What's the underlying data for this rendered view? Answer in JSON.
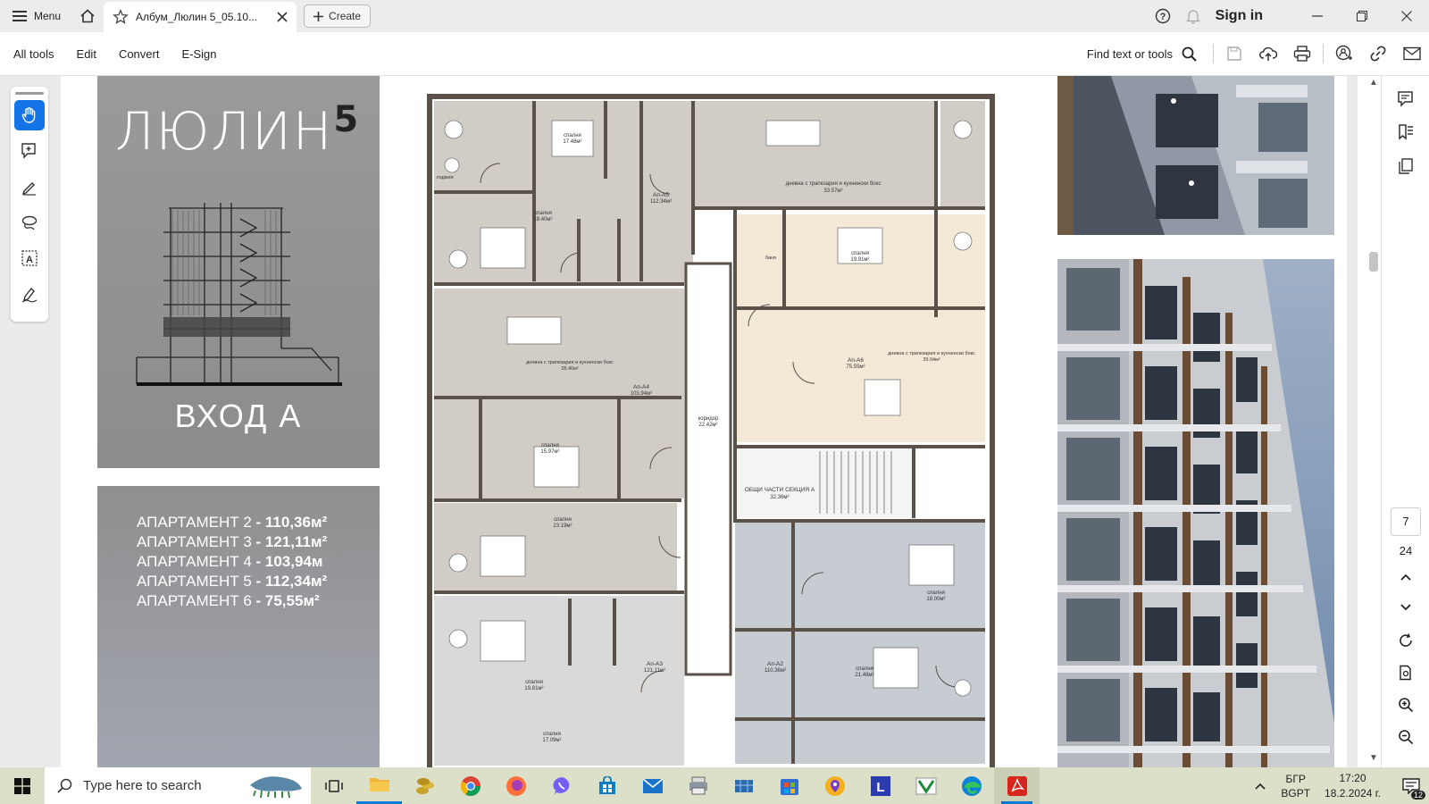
{
  "titlebar": {
    "menu_label": "Menu",
    "tab_title": "Албум_Люлин 5_05.10...",
    "create_label": "Create",
    "signin_label": "Sign in"
  },
  "toolbar": {
    "menu_items": [
      "All tools",
      "Edit",
      "Convert",
      "E-Sign"
    ],
    "find_label": "Find text or tools"
  },
  "document": {
    "cover_title": "ЛЮЛИН",
    "cover_title_mark": "5",
    "entrance_label": "ВХОД А",
    "apartments": [
      {
        "name": "АПАРТАМЕНТ 2",
        "area": "- 110,36м²"
      },
      {
        "name": "АПАРТАМЕНТ 3",
        "area": " - 121,11м²"
      },
      {
        "name": "АПАРТАМЕНТ 4",
        "area": " - 103,94м"
      },
      {
        "name": "АПАРТАМЕНТ 5",
        "area": "- 112,34м²"
      },
      {
        "name": "АПАРТАМЕНТ 6",
        "area": "- 75,55м²"
      }
    ],
    "plan_labels": {
      "a5": "Ап-А5",
      "a5_area": "112.34м²",
      "a4": "Ап-А4",
      "a4_area": "103.94м²",
      "a6": "Ап-А6",
      "a6_area": "75.55м²",
      "a3": "Ап-А3",
      "a3_area": "121.11м²",
      "a2": "Ап-А2",
      "a2_area": "110.36м²",
      "corridor": "коридор",
      "corridor_area": "22.42м²",
      "common": "ОБЩИ ЧАСТИ СЕКЦИЯ А",
      "common_area": "32.36м²",
      "living": "дневна с трапезария и кухненски бокс",
      "bedroom": "спалня",
      "bath": "баня",
      "lodge": "лоджия",
      "a53_area": "33.57м²",
      "a64_area": "39.04м²",
      "a45_area": "28.40м²",
      "a57_area": "17.48м²",
      "a58_area": "18.40м²",
      "a65_area": "19.91м²",
      "a46_area": "15.97м²",
      "a47_area": "23.19м²",
      "a27_area": "18.00м²",
      "a26_area": "21.48м²",
      "a38_area": "19.81м²",
      "a37_area": "17.09м²"
    }
  },
  "pager": {
    "current": "7",
    "total": "24"
  },
  "taskbar": {
    "search_placeholder": "Type here to search",
    "lang_top": "БГР",
    "lang_bottom": "BGPT",
    "time": "17:20",
    "date": "18.2.2024 г.",
    "notif_count": "12"
  },
  "colors": {
    "accent": "#1473e6",
    "taskbar": "#dce0c8",
    "cover_gray": "#8f8f8f",
    "unit_gray": "#d2ccc6",
    "unit_beige": "#f4e8d6",
    "unit_blue": "#c6ccd2",
    "unit_light": "#d9d9d9",
    "wall": "#5a5148"
  }
}
